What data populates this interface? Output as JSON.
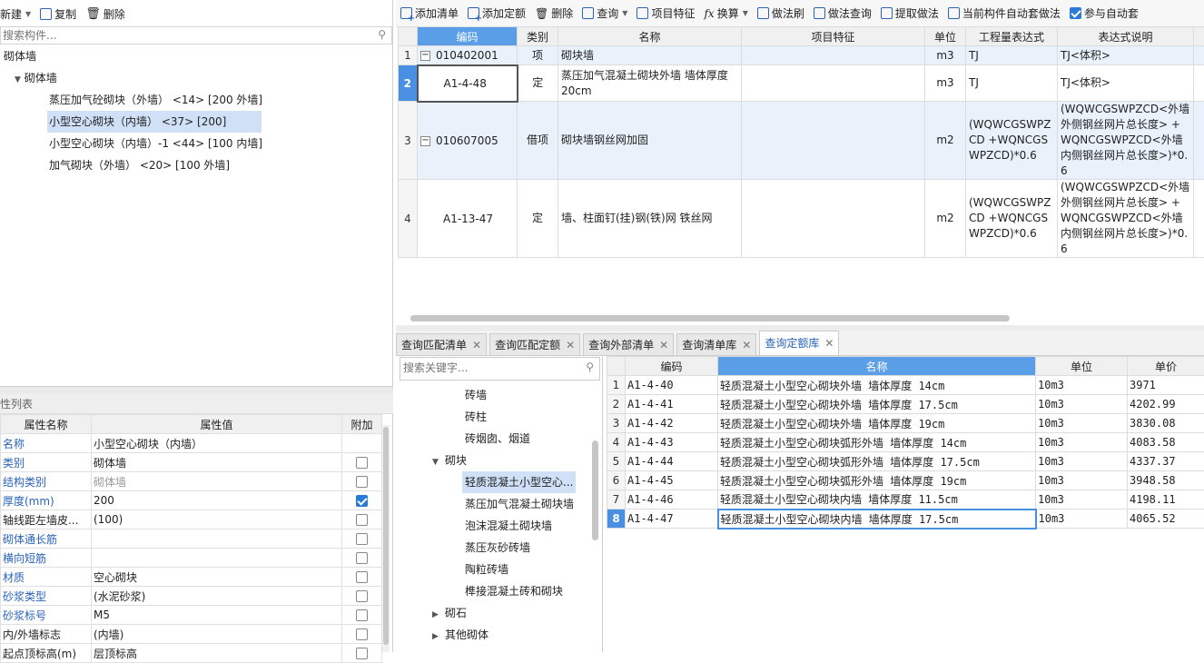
{
  "left": {
    "toolbar": {
      "new": "新建",
      "copy": "复制",
      "delete": "删除"
    },
    "search_placeholder": "搜索构件...",
    "tree": {
      "root": "砌体墙",
      "group": "砌体墙",
      "items": [
        "蒸压加气砼砌块（外墙） <14> [200 外墙]",
        "小型空心砌块（内墙） <37> [200]",
        "小型空心砌块（内墙）-1 <44> [100 内墙]",
        "加气砌块（外墙） <20> [100 外墙]"
      ]
    },
    "props": {
      "title": "性列表",
      "headers": [
        "属性名称",
        "属性值",
        "附加"
      ],
      "rows": [
        {
          "name": "名称",
          "value": "小型空心砌块（内墙）",
          "blue": true,
          "check": null
        },
        {
          "name": "类别",
          "value": "砌体墙",
          "blue": true,
          "check": false
        },
        {
          "name": "结构类别",
          "value": "砌体墙",
          "blue": true,
          "check": false,
          "gray": true
        },
        {
          "name": "厚度(mm)",
          "value": "200",
          "blue": true,
          "check": true
        },
        {
          "name": "轴线距左墙皮...",
          "value": "(100)",
          "blue": false,
          "check": false
        },
        {
          "name": "砌体通长筋",
          "value": "",
          "blue": true,
          "check": false
        },
        {
          "name": "横向短筋",
          "value": "",
          "blue": true,
          "check": false
        },
        {
          "name": "材质",
          "value": "空心砌块",
          "blue": true,
          "check": false
        },
        {
          "name": "砂浆类型",
          "value": "(水泥砂浆)",
          "blue": true,
          "check": false
        },
        {
          "name": "砂浆标号",
          "value": "M5",
          "blue": true,
          "check": false
        },
        {
          "name": "内/外墙标志",
          "value": "(内墙)",
          "blue": false,
          "check": false
        },
        {
          "name": "起点顶标高(m)",
          "value": "层顶标高",
          "blue": false,
          "check": false
        }
      ]
    }
  },
  "right": {
    "toolbar": [
      "添加清单",
      "添加定额",
      "删除",
      "查询",
      "项目特征",
      "换算",
      "做法刷",
      "做法查询",
      "提取做法",
      "当前构件自动套做法",
      "参与自动套"
    ],
    "table": {
      "headers": [
        "编码",
        "类别",
        "名称",
        "项目特征",
        "单位",
        "工程量表达式",
        "表达式说明"
      ],
      "rows": [
        {
          "n": "1",
          "code": "010402001",
          "type": "项",
          "name": "砌块墙",
          "feat": "",
          "unit": "m3",
          "expr": "TJ",
          "desc": "TJ<体积>",
          "lvl": 0
        },
        {
          "n": "2",
          "code": "A1-4-48",
          "type": "定",
          "name": "蒸压加气混凝土砌块外墙 墙体厚度 20cm",
          "feat": "",
          "unit": "m3",
          "expr": "TJ",
          "desc": "TJ<体积>",
          "lvl": 1
        },
        {
          "n": "3",
          "code": "010607005",
          "type": "借项",
          "name": "砌块墙钢丝网加固",
          "feat": "",
          "unit": "m2",
          "expr": "(WQWCGSWPZCD +WQNCGSWPZCD)*0.6",
          "desc": "(WQWCGSWPZCD<外墙外侧钢丝网片总长度> +WQNCGSWPZCD<外墙内侧钢丝网片总长度>)*0.6",
          "lvl": 0
        },
        {
          "n": "4",
          "code": "A1-13-47",
          "type": "定",
          "name": "墙、柱面钉(挂)钢(铁)网 铁丝网",
          "feat": "",
          "unit": "m2",
          "expr": "(WQWCGSWPZCD +WQNCGSWPZCD)*0.6",
          "desc": "(WQWCGSWPZCD<外墙外侧钢丝网片总长度> +WQNCGSWPZCD<外墙内侧钢丝网片总长度>)*0.6",
          "lvl": 1
        }
      ]
    },
    "tabs": [
      "查询匹配清单",
      "查询匹配定额",
      "查询外部清单",
      "查询清单库",
      "查询定额库"
    ],
    "q_search_placeholder": "搜索关键字...",
    "q_tree": [
      {
        "t": "砖墙",
        "lvl": 2
      },
      {
        "t": "砖柱",
        "lvl": 2
      },
      {
        "t": "砖烟囱、烟道",
        "lvl": 2
      },
      {
        "t": "砌块",
        "lvl": 1,
        "open": true
      },
      {
        "t": "轻质混凝土小型空心...",
        "lvl": 2,
        "sel": true
      },
      {
        "t": "蒸压加气混凝土砌块墙",
        "lvl": 2
      },
      {
        "t": "泡沫混凝土砌块墙",
        "lvl": 2
      },
      {
        "t": "蒸压灰砂砖墙",
        "lvl": 2
      },
      {
        "t": "陶粒砖墙",
        "lvl": 2
      },
      {
        "t": "榫接混凝土砖和砌块",
        "lvl": 2
      },
      {
        "t": "砌石",
        "lvl": 1
      },
      {
        "t": "其他砌体",
        "lvl": 1
      }
    ],
    "q_table": {
      "headers": [
        "编码",
        "名称",
        "单位",
        "单价"
      ],
      "rows": [
        [
          "1",
          "A1-4-40",
          "轻质混凝土小型空心砌块外墙 墙体厚度 14cm",
          "10m3",
          "3971"
        ],
        [
          "2",
          "A1-4-41",
          "轻质混凝土小型空心砌块外墙 墙体厚度 17.5cm",
          "10m3",
          "4202.99"
        ],
        [
          "3",
          "A1-4-42",
          "轻质混凝土小型空心砌块外墙 墙体厚度 19cm",
          "10m3",
          "3830.08"
        ],
        [
          "4",
          "A1-4-43",
          "轻质混凝土小型空心砌块弧形外墙 墙体厚度 14cm",
          "10m3",
          "4083.58"
        ],
        [
          "5",
          "A1-4-44",
          "轻质混凝土小型空心砌块弧形外墙 墙体厚度 17.5cm",
          "10m3",
          "4337.37"
        ],
        [
          "6",
          "A1-4-45",
          "轻质混凝土小型空心砌块弧形外墙 墙体厚度 19cm",
          "10m3",
          "3948.58"
        ],
        [
          "7",
          "A1-4-46",
          "轻质混凝土小型空心砌块内墙 墙体厚度 11.5cm",
          "10m3",
          "4198.11"
        ],
        [
          "8",
          "A1-4-47",
          "轻质混凝土小型空心砌块内墙 墙体厚度 17.5cm",
          "10m3",
          "4065.52"
        ]
      ]
    }
  }
}
